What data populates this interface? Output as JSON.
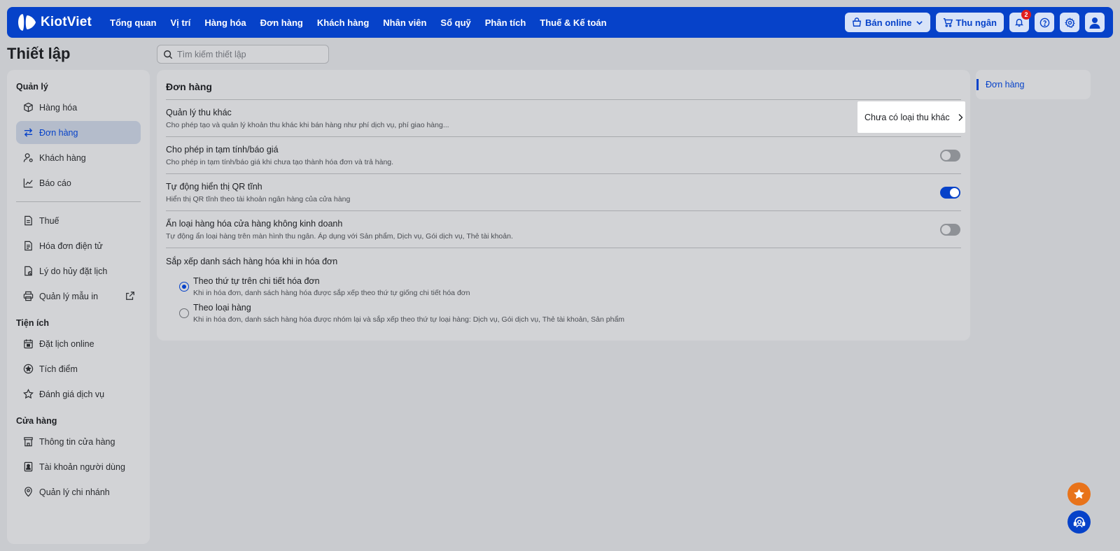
{
  "topnav": {
    "brand": "KiotViet",
    "items": [
      "Tổng quan",
      "Vị trí",
      "Hàng hóa",
      "Đơn hàng",
      "Khách hàng",
      "Nhân viên",
      "Sổ quỹ",
      "Phân tích",
      "Thuế & Kế toán"
    ],
    "online_label": "Bán online",
    "cashier_label": "Thu ngân",
    "notification_count": "2"
  },
  "page": {
    "title": "Thiết lập",
    "search_placeholder": "Tìm kiếm thiết lập"
  },
  "sidebar": {
    "sections": [
      {
        "title": "Quản lý",
        "items": [
          {
            "label": "Hàng hóa",
            "icon": "box-icon"
          },
          {
            "label": "Đơn hàng",
            "icon": "swap-icon",
            "active": true
          },
          {
            "label": "Khách hàng",
            "icon": "user-settings-icon"
          },
          {
            "label": "Báo cáo",
            "icon": "chart-icon"
          }
        ]
      },
      {
        "title": "",
        "items": [
          {
            "label": "Thuế",
            "icon": "tax-doc-icon"
          },
          {
            "label": "Hóa đơn điện tử",
            "icon": "document-icon"
          },
          {
            "label": "Lý do hủy đặt lịch",
            "icon": "calendar-cancel-icon"
          },
          {
            "label": "Quản lý mẫu in",
            "icon": "printer-icon",
            "external": true
          }
        ]
      },
      {
        "title": "Tiện ích",
        "items": [
          {
            "label": "Đặt lịch online",
            "icon": "calendar-icon"
          },
          {
            "label": "Tích điểm",
            "icon": "star-circle-icon"
          },
          {
            "label": "Đánh giá dịch vụ",
            "icon": "star-icon"
          }
        ]
      },
      {
        "title": "Cửa hàng",
        "items": [
          {
            "label": "Thông tin cửa hàng",
            "icon": "store-icon"
          },
          {
            "label": "Tài khoản người dùng",
            "icon": "user-card-icon"
          },
          {
            "label": "Quản lý chi nhánh",
            "icon": "location-icon"
          }
        ]
      }
    ]
  },
  "main": {
    "title": "Đơn hàng",
    "rows": [
      {
        "title": "Quản lý thu khác",
        "desc": "Cho phép tạo và quản lý khoản thu khác khi bán hàng như phí dịch vụ, phí giao hàng...",
        "link": "Chưa có loại thu khác"
      },
      {
        "title": "Cho phép in tạm tính/báo giá",
        "desc": "Cho phép in tạm tính/báo giá khi chưa tạo thành hóa đơn và trả hàng.",
        "toggle": false
      },
      {
        "title": "Tự động hiển thị QR tĩnh",
        "desc": "Hiển thị QR tĩnh theo tài khoản ngân hàng của cửa hàng",
        "toggle": true
      },
      {
        "title": "Ẩn loại hàng hóa cửa hàng không kinh doanh",
        "desc": "Tự động ẩn loại hàng trên màn hình thu ngân. Áp dụng với Sản phẩm, Dịch vụ, Gói dịch vụ, Thẻ tài khoản.",
        "toggle": false
      }
    ],
    "sort": {
      "title": "Sắp xếp danh sách hàng hóa khi in hóa đơn",
      "options": [
        {
          "title": "Theo thứ tự trên chi tiết hóa đơn",
          "desc": "Khi in hóa đơn, danh sách hàng hóa được sắp xếp theo thứ tự giống chi tiết hóa đơn",
          "selected": true
        },
        {
          "title": "Theo loại hàng",
          "desc": "Khi in hóa đơn, danh sách hàng hóa được nhóm lại và sắp xếp theo thứ tự loại hàng: Dịch vụ, Gói dịch vụ, Thẻ tài khoản, Sản phẩm",
          "selected": false
        }
      ]
    }
  },
  "anchor": {
    "label": "Đơn hàng"
  },
  "colors": {
    "brand": "#0642c9",
    "fab_orange": "#e8731a"
  }
}
